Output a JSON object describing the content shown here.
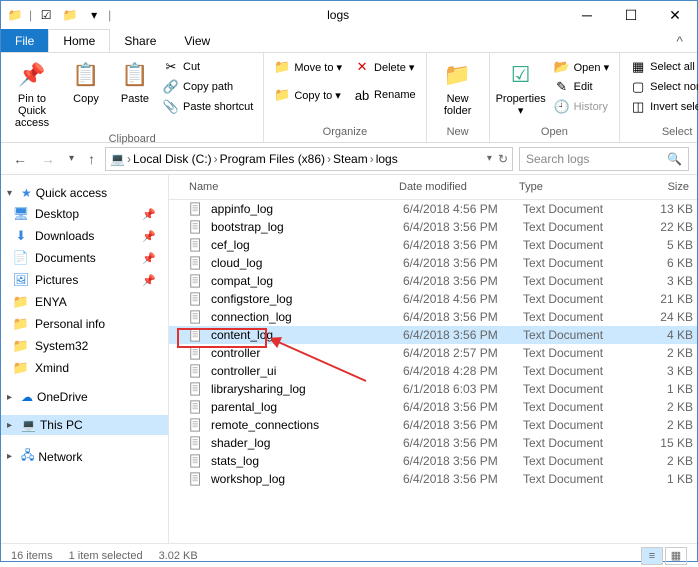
{
  "window": {
    "title": "logs"
  },
  "tabs": {
    "file": "File",
    "home": "Home",
    "share": "Share",
    "view": "View"
  },
  "ribbon": {
    "clipboard": {
      "label": "Clipboard",
      "pin": "Pin to Quick access",
      "copy": "Copy",
      "paste": "Paste",
      "cut": "Cut",
      "copy_path": "Copy path",
      "paste_shortcut": "Paste shortcut"
    },
    "organize": {
      "label": "Organize",
      "move_to": "Move to ▾",
      "copy_to": "Copy to ▾",
      "delete": "Delete ▾",
      "rename": "Rename"
    },
    "new": {
      "label": "New",
      "new_folder": "New folder"
    },
    "open": {
      "label": "Open",
      "properties": "Properties ▾",
      "open": "Open ▾",
      "edit": "Edit",
      "history": "History"
    },
    "select": {
      "label": "Select",
      "select_all": "Select all",
      "select_none": "Select none",
      "invert": "Invert selection"
    }
  },
  "breadcrumb": [
    "Local Disk (C:)",
    "Program Files (x86)",
    "Steam",
    "logs"
  ],
  "search": {
    "placeholder": "Search logs"
  },
  "sidebar": {
    "quick_access": {
      "label": "Quick access",
      "items": [
        {
          "icon": "desktop",
          "label": "Desktop",
          "pinned": true
        },
        {
          "icon": "download",
          "label": "Downloads",
          "pinned": true
        },
        {
          "icon": "document",
          "label": "Documents",
          "pinned": true
        },
        {
          "icon": "picture",
          "label": "Pictures",
          "pinned": true
        },
        {
          "icon": "folder",
          "label": "ENYA",
          "pinned": false
        },
        {
          "icon": "folder",
          "label": "Personal info",
          "pinned": false
        },
        {
          "icon": "folder",
          "label": "System32",
          "pinned": false
        },
        {
          "icon": "folder",
          "label": "Xmind",
          "pinned": false
        }
      ]
    },
    "onedrive": {
      "label": "OneDrive"
    },
    "this_pc": {
      "label": "This PC",
      "selected": true
    },
    "network": {
      "label": "Network"
    }
  },
  "columns": {
    "name": "Name",
    "date": "Date modified",
    "type": "Type",
    "size": "Size"
  },
  "files": [
    {
      "name": "appinfo_log",
      "date": "6/4/2018 4:56 PM",
      "type": "Text Document",
      "size": "13 KB",
      "selected": false
    },
    {
      "name": "bootstrap_log",
      "date": "6/4/2018 3:56 PM",
      "type": "Text Document",
      "size": "22 KB",
      "selected": false
    },
    {
      "name": "cef_log",
      "date": "6/4/2018 3:56 PM",
      "type": "Text Document",
      "size": "5 KB",
      "selected": false
    },
    {
      "name": "cloud_log",
      "date": "6/4/2018 3:56 PM",
      "type": "Text Document",
      "size": "6 KB",
      "selected": false
    },
    {
      "name": "compat_log",
      "date": "6/4/2018 3:56 PM",
      "type": "Text Document",
      "size": "3 KB",
      "selected": false
    },
    {
      "name": "configstore_log",
      "date": "6/4/2018 4:56 PM",
      "type": "Text Document",
      "size": "21 KB",
      "selected": false
    },
    {
      "name": "connection_log",
      "date": "6/4/2018 3:56 PM",
      "type": "Text Document",
      "size": "24 KB",
      "selected": false
    },
    {
      "name": "content_log",
      "date": "6/4/2018 3:56 PM",
      "type": "Text Document",
      "size": "4 KB",
      "selected": true
    },
    {
      "name": "controller",
      "date": "6/4/2018 2:57 PM",
      "type": "Text Document",
      "size": "2 KB",
      "selected": false
    },
    {
      "name": "controller_ui",
      "date": "6/4/2018 4:28 PM",
      "type": "Text Document",
      "size": "3 KB",
      "selected": false
    },
    {
      "name": "librarysharing_log",
      "date": "6/1/2018 6:03 PM",
      "type": "Text Document",
      "size": "1 KB",
      "selected": false
    },
    {
      "name": "parental_log",
      "date": "6/4/2018 3:56 PM",
      "type": "Text Document",
      "size": "2 KB",
      "selected": false
    },
    {
      "name": "remote_connections",
      "date": "6/4/2018 3:56 PM",
      "type": "Text Document",
      "size": "2 KB",
      "selected": false
    },
    {
      "name": "shader_log",
      "date": "6/4/2018 3:56 PM",
      "type": "Text Document",
      "size": "15 KB",
      "selected": false
    },
    {
      "name": "stats_log",
      "date": "6/4/2018 3:56 PM",
      "type": "Text Document",
      "size": "2 KB",
      "selected": false
    },
    {
      "name": "workshop_log",
      "date": "6/4/2018 3:56 PM",
      "type": "Text Document",
      "size": "1 KB",
      "selected": false
    }
  ],
  "status": {
    "count": "16 items",
    "selection": "1 item selected",
    "size": "3.02 KB"
  },
  "icons": {
    "folder": "📁",
    "star": "★",
    "desktop": "🖥",
    "download": "↓",
    "document": "📄",
    "picture": "🖼",
    "cloud": "☁",
    "pc": "💻",
    "network": "🔗",
    "search": "🔍",
    "scissors": "✂",
    "pin": "📌",
    "refresh": "↻"
  }
}
